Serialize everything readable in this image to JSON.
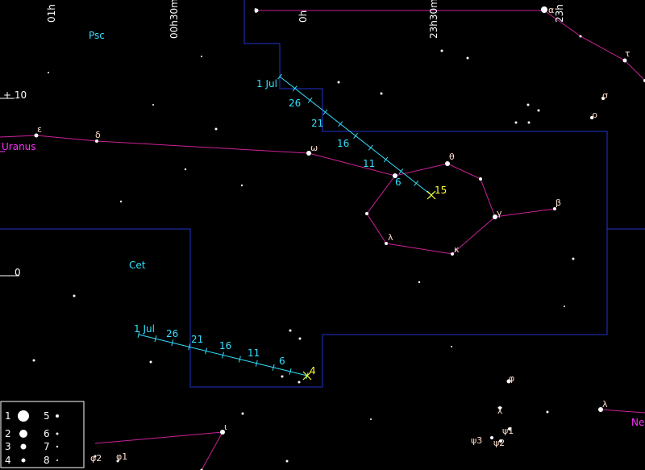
{
  "grid_labels": {
    "ra": [
      "01h",
      "00h30m",
      "0h",
      "23h30m",
      "23h"
    ],
    "dec": [
      "+ 10",
      "0"
    ]
  },
  "constellations": [
    "Psc",
    "Cet"
  ],
  "planets": [
    "Uranus",
    "Ne"
  ],
  "greek_labels": {
    "iota_psc": "ι",
    "alpha": "α",
    "epsilon": "ε",
    "delta": "δ",
    "omega": "ω",
    "theta": "θ",
    "gamma": "γ",
    "beta": "β",
    "lambda": "λ",
    "kappa": "κ",
    "tau": "τ",
    "sigma": "σ",
    "rho": "ρ",
    "iota_cet": "ι",
    "phi": "φ",
    "chi": "χ",
    "lambda2": "λ",
    "phi2": "φ2",
    "phi1": "φ1",
    "psi3": "ψ3",
    "psi2": "ψ2",
    "psi1": "ψ1"
  },
  "track_upper": {
    "labels": [
      "1 Jul",
      "26",
      "21",
      "16",
      "11",
      "6"
    ],
    "end_label": "15"
  },
  "track_lower": {
    "labels": [
      "1 Jul",
      "26",
      "21",
      "16",
      "11",
      "6"
    ],
    "end_label": "4"
  },
  "legend": {
    "magnitudes": [
      "1",
      "2",
      "3",
      "4",
      "5",
      "6",
      "7",
      "8"
    ]
  },
  "colors": {
    "background": "#000000",
    "boundary": "#2233cc",
    "figure": "#cc2299",
    "track": "#33e0ff",
    "label": "#33e0ff",
    "planet": "#ff33ff",
    "end_marker": "#ffff33"
  }
}
